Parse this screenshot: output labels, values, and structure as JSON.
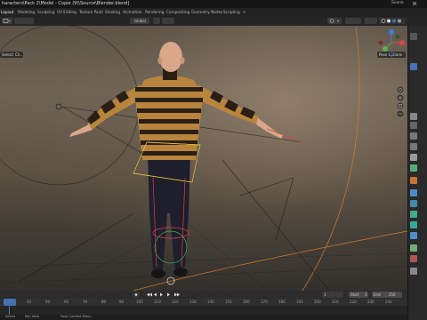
{
  "window": {
    "title": "haracters\\Pack 2\\Model - Copie (9)\\Source\\Blender.blend]",
    "scene_label": "Scene"
  },
  "workspace_tabs": [
    "Layout",
    "Modeling",
    "Sculpting",
    "UV Editing",
    "Texture Paint",
    "Shading",
    "Animation",
    "Rendering",
    "Compositing",
    "Geometry Nodes",
    "Scripting",
    "+"
  ],
  "active_tab": "Layout",
  "header": {
    "select_label": "Select: Cli...",
    "global_label": "Global",
    "pose_options": "Pose Options"
  },
  "timeline": {
    "current_frame": "1",
    "start_label": "Start",
    "start_value": "1",
    "end_label": "End",
    "end_value": "250",
    "ruler_ticks": [
      "0",
      "40",
      "50",
      "60",
      "70",
      "80",
      "90",
      "100",
      "110",
      "120",
      "130",
      "140",
      "150",
      "160",
      "170",
      "180",
      "190",
      "200",
      "210",
      "220",
      "230",
      "240",
      "250"
    ]
  },
  "status_bar": {
    "select_hint": "Select",
    "pan_hint": "Pan View",
    "context_hint": "Pose Context Menu"
  },
  "colors": {
    "accent": "#4772b3",
    "sweater_dark": "#2a1f14",
    "sweater_light": "#b8843e",
    "skin": "#d9a789",
    "pants": "#1f1e2c",
    "bone_yellow": "#e8c23a",
    "bone_red": "#d94444"
  }
}
